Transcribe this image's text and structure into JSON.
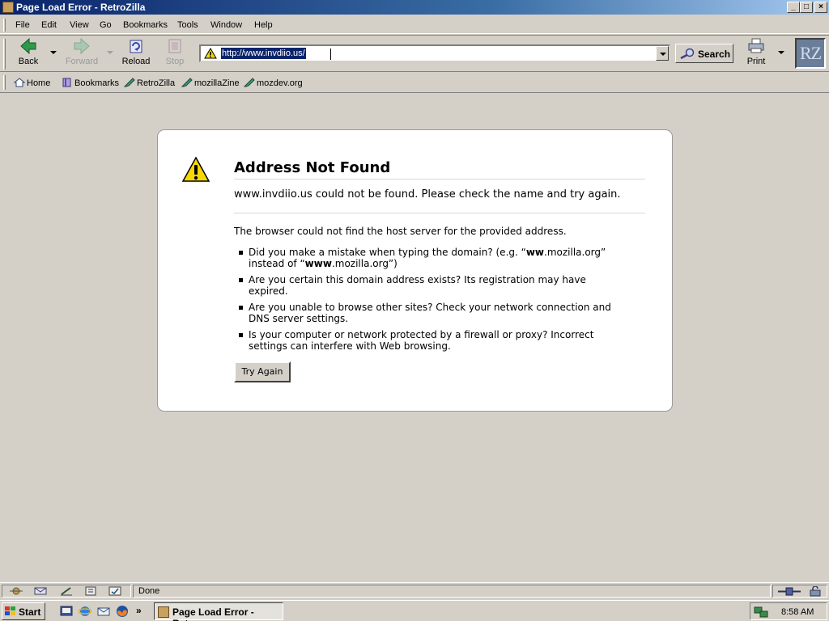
{
  "window": {
    "title": "Page Load Error - RetroZilla"
  },
  "menu": [
    "File",
    "Edit",
    "View",
    "Go",
    "Bookmarks",
    "Tools",
    "Window",
    "Help"
  ],
  "nav": {
    "back": "Back",
    "forward": "Forward",
    "reload": "Reload",
    "stop": "Stop",
    "url": "http://www.invdiio.us/",
    "search": "Search",
    "print": "Print",
    "throbber": "RZ"
  },
  "personal_toolbar": [
    "Home",
    "Bookmarks",
    "RetroZilla",
    "mozillaZine",
    "mozdev.org"
  ],
  "error": {
    "title": "Address Not Found",
    "short_desc": "www.invdiio.us could not be found. Please check the name and try again.",
    "long_desc": "The browser could not find the host server for the provided address.",
    "bullets": {
      "b1_pre": "Did you make a mistake when typing the domain? (e.g. “",
      "b1_bold1": "ww",
      "b1_mid": ".mozilla.org” instead of “",
      "b1_bold2": "www",
      "b1_post": ".mozilla.org”)",
      "b2": "Are you certain this domain address exists? Its registration may have expired.",
      "b3": "Are you unable to browse other sites? Check your network connection and DNS server settings.",
      "b4": "Is your computer or network protected by a firewall or proxy? Incorrect settings can interfere with Web browsing."
    },
    "try_again": "Try Again"
  },
  "status": {
    "text": "Done"
  },
  "taskbar": {
    "start": "Start",
    "chevron": "»",
    "task": "Page Load Error - Retr...",
    "clock": "8:58 AM"
  },
  "colors": {
    "titlebar": "#0a246a",
    "selection": "#0a246a",
    "warning": "#f5d800"
  },
  "icons": [
    "back-icon",
    "forward-icon",
    "reload-icon",
    "stop-icon",
    "warning-icon",
    "search-icon",
    "print-icon",
    "home-icon",
    "bookmarks-icon",
    "bookmark-icon"
  ]
}
